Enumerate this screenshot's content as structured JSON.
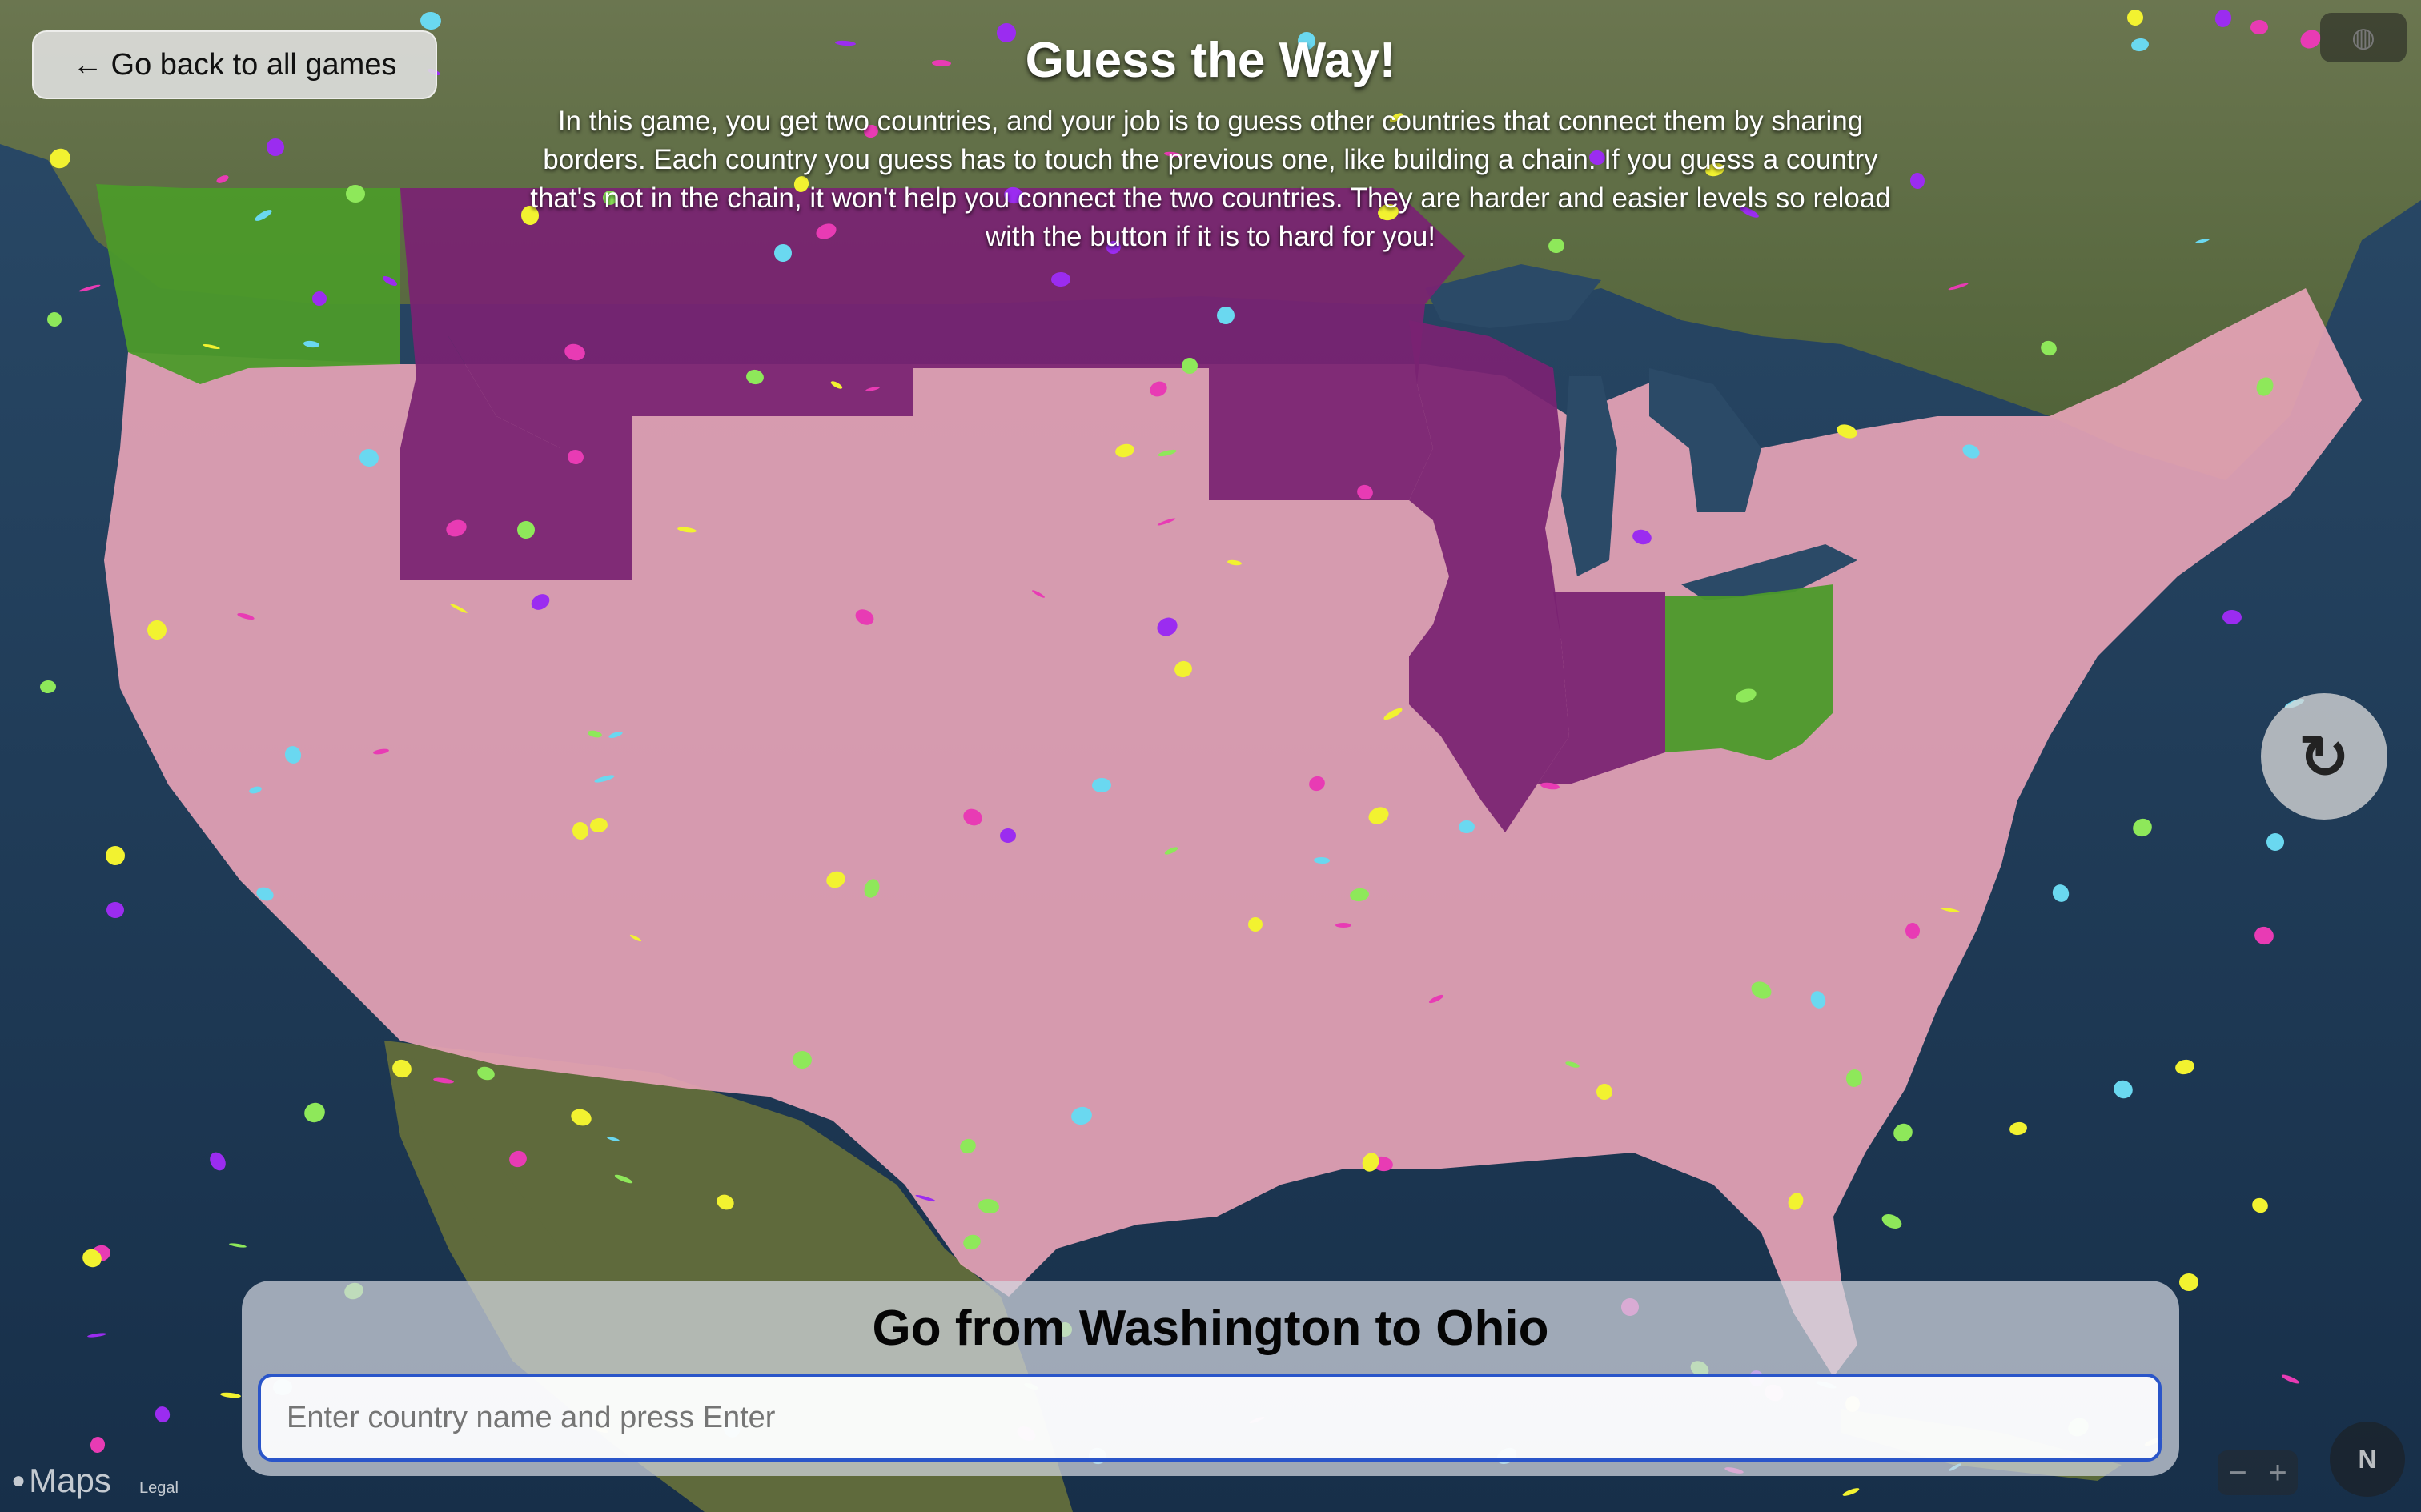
{
  "header": {
    "back_label": "Go back to all games",
    "back_arrow": "←",
    "title": "Guess the Way!",
    "description": "In this game, you get two countries, and your job is to guess other countries that connect them by sharing borders. Each country you guess has to touch the previous one, like building a chain. If you guess a country that's not in the chain, it won't help you connect the two countries. They are harder and easier levels so reload with the button if it is to hard for you!"
  },
  "reload": {
    "glyph": "↻",
    "icon": "reload-icon"
  },
  "globe": {
    "icon": "globe-icon"
  },
  "game": {
    "goal": "Go from Washington to Ohio",
    "input_placeholder": "Enter country name and press Enter",
    "start": "Washington",
    "end": "Ohio"
  },
  "map": {
    "attribution": "Maps",
    "legal": "Legal",
    "zoom_out": "−",
    "zoom_in": "+",
    "compass": "N",
    "colors": {
      "ocean": "#1f3d5c",
      "land": "#5b6b3a",
      "us_fill": "#e6a3b6",
      "endpoint_fill": "#4c9a2a",
      "path_fill": "#7a2272",
      "confetti": [
        "#e83bb4",
        "#f2f230",
        "#8ee85a",
        "#6ad8f0",
        "#9b2cf0"
      ]
    },
    "highlighted_states": [
      {
        "name": "Washington",
        "role": "start"
      },
      {
        "name": "Ohio",
        "role": "end"
      },
      {
        "name": "Idaho",
        "role": "path"
      },
      {
        "name": "Montana",
        "role": "path"
      },
      {
        "name": "North Dakota",
        "role": "path"
      },
      {
        "name": "Minnesota",
        "role": "path"
      },
      {
        "name": "Wisconsin",
        "role": "path"
      },
      {
        "name": "Illinois",
        "role": "path"
      },
      {
        "name": "Indiana",
        "role": "path"
      }
    ]
  }
}
